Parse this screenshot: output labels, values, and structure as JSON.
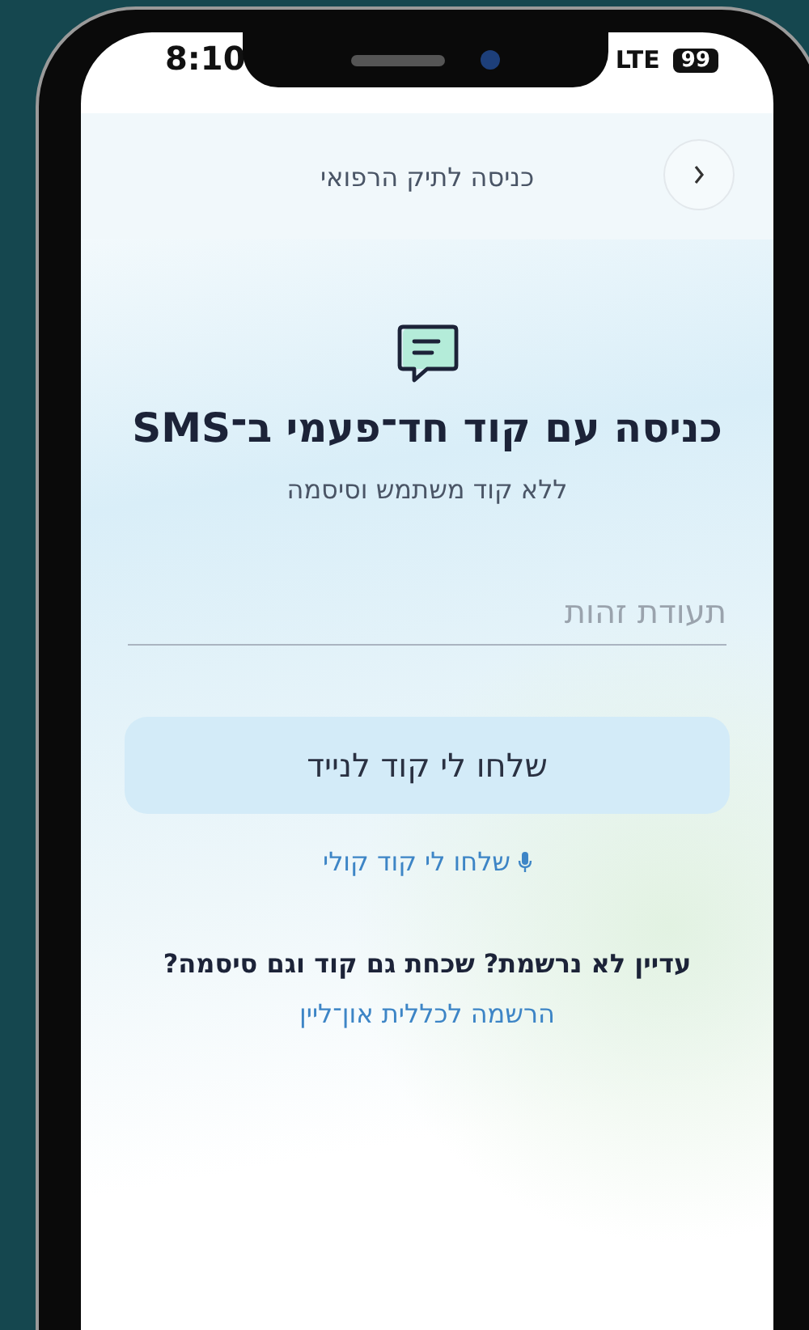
{
  "status_bar": {
    "time": "8:10",
    "network": "LTE",
    "battery": "99"
  },
  "header": {
    "title": "כניסה לתיק הרפואי"
  },
  "login": {
    "title": "כניסה עם קוד חד־פעמי ב־SMS",
    "subtitle": "ללא קוד משתמש וסיסמה",
    "id_field": {
      "placeholder": "תעודת זהות"
    },
    "send_button": "שלחו לי קוד לנייד",
    "voice_link": "שלחו לי קוד קולי",
    "register_prompt": "עדיין לא נרשמת? שכחת גם קוד וגם סיסמה?",
    "register_link": "הרשמה לכללית און־ליין"
  }
}
